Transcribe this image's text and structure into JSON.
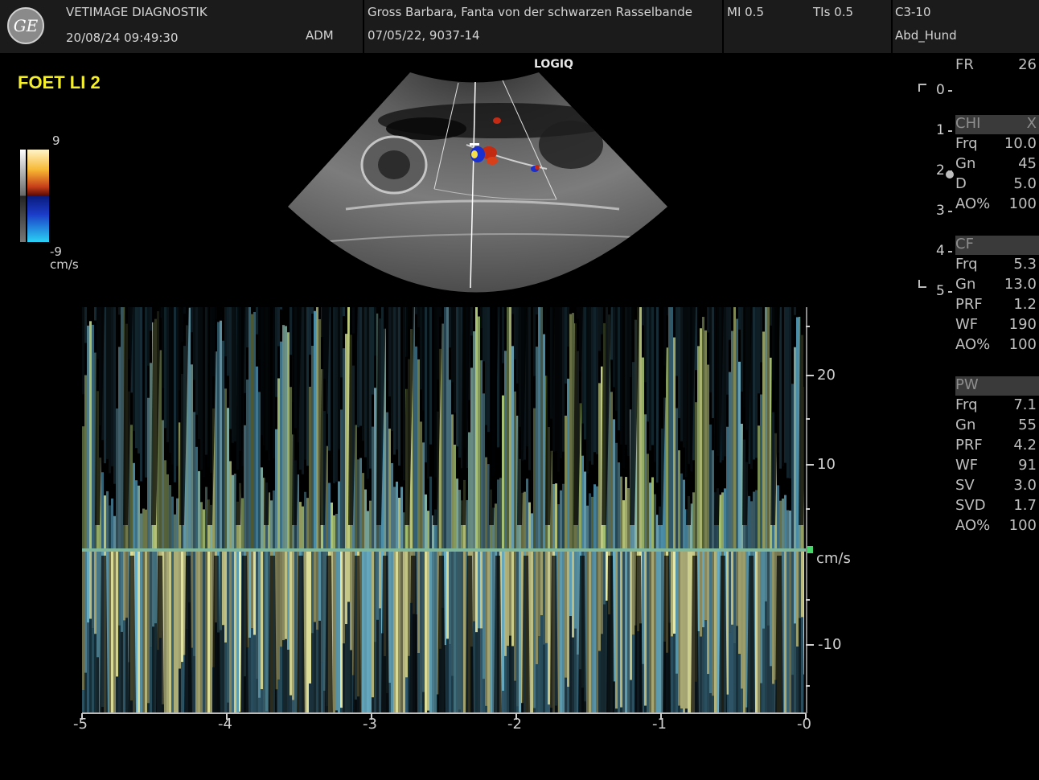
{
  "header": {
    "institution": "VETIMAGE DIAGNOSTIK",
    "datetime": "20/08/24 09:49:30",
    "operator": "ADM",
    "patient": "Gross Barbara, Fanta von der schwarzen Rasselbande",
    "patient_info": "07/05/22, 9037-14",
    "mi": "MI 0.5",
    "tis": "TIs 0.5",
    "probe": "C3-10",
    "application": "Abd_Hund",
    "logo_text": "GE"
  },
  "preset_label": "FOET LI 2",
  "brand": "LOGIQ",
  "color_scale": {
    "max": "9",
    "min": "-9",
    "unit": "cm/s"
  },
  "depth_scale": [
    "0",
    "1",
    "2",
    "3",
    "4",
    "5"
  ],
  "params": {
    "fr": {
      "k": "FR",
      "v": "26"
    },
    "chi_header": {
      "k": "CHI",
      "v": "X"
    },
    "chi": [
      {
        "k": "Frq",
        "v": "10.0"
      },
      {
        "k": "Gn",
        "v": "45"
      },
      {
        "k": "D",
        "v": "5.0"
      },
      {
        "k": "AO%",
        "v": "100"
      }
    ],
    "cf_header": {
      "k": "CF"
    },
    "cf": [
      {
        "k": "Frq",
        "v": "5.3"
      },
      {
        "k": "Gn",
        "v": "13.0"
      },
      {
        "k": "PRF",
        "v": "1.2"
      },
      {
        "k": "WF",
        "v": "190"
      },
      {
        "k": "AO%",
        "v": "100"
      }
    ],
    "pw_header": {
      "k": "PW"
    },
    "pw": [
      {
        "k": "Frq",
        "v": "7.1"
      },
      {
        "k": "Gn",
        "v": "55"
      },
      {
        "k": "PRF",
        "v": "4.2"
      },
      {
        "k": "WF",
        "v": "91"
      },
      {
        "k": "SV",
        "v": "3.0"
      },
      {
        "k": "SVD",
        "v": "1.7"
      },
      {
        "k": "AO%",
        "v": "100"
      }
    ]
  },
  "spectrum": {
    "y_unit": "cm/s",
    "y_ticks": [
      "20",
      "10",
      "-10"
    ],
    "x_ticks": [
      "-5",
      "-4",
      "-3",
      "-2",
      "-1",
      "-0"
    ],
    "baseline_color": "#7fb59a"
  }
}
